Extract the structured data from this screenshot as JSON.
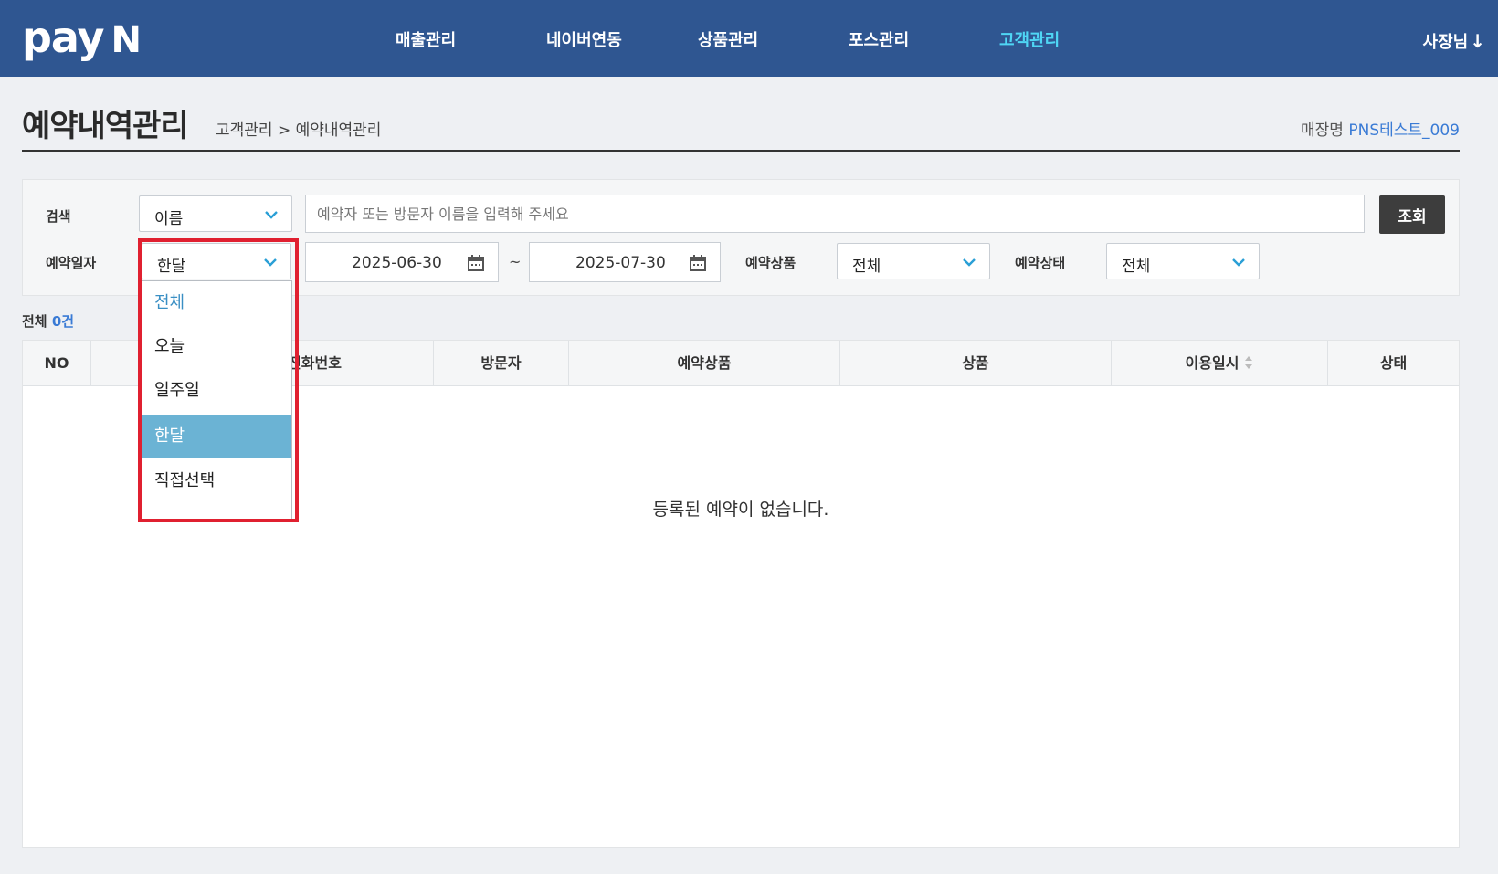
{
  "brand": {
    "logo_text": "pay",
    "logo_n": "N"
  },
  "nav": {
    "items": [
      "매출관리",
      "네이버연동",
      "상품관리",
      "포스관리",
      "고객관리"
    ],
    "active": "고객관리",
    "user": "사장님"
  },
  "page": {
    "title": "예약내역관리",
    "breadcrumb": "고객관리 > 예약내역관리",
    "store_label": "매장명",
    "store_name": "PNS테스트_009"
  },
  "filters": {
    "search_label": "검색",
    "search_type": "이름",
    "search_placeholder": "예약자 또는 방문자 이름을 입력해 주세요",
    "search_button": "조회",
    "date_label": "예약일자",
    "date_range_value": "한달",
    "date_from": "2025-06-30",
    "date_to": "2025-07-30",
    "date_separator": "~",
    "product_label": "예약상품",
    "product_value": "전체",
    "status_label": "예약상태",
    "status_value": "전체"
  },
  "total": {
    "label": "전체",
    "count": "0건"
  },
  "table": {
    "columns": [
      "NO",
      "",
      "약자 전화번호",
      "방문자",
      "예약상품",
      "상품",
      "이용일시",
      "상태"
    ],
    "empty_message": "등록된 예약이 없습니다."
  },
  "dropdown": {
    "options": [
      "전체",
      "오늘",
      "일주일",
      "한달",
      "직접선택"
    ],
    "selected": "한달"
  },
  "colors": {
    "nav_bg": "#2f5691",
    "nav_active": "#4fd6f5",
    "accent_blue": "#3a7bd5",
    "selected_option_bg": "#6bb3d4",
    "highlight_border": "#e02030",
    "chevron": "#2a9fd6"
  }
}
